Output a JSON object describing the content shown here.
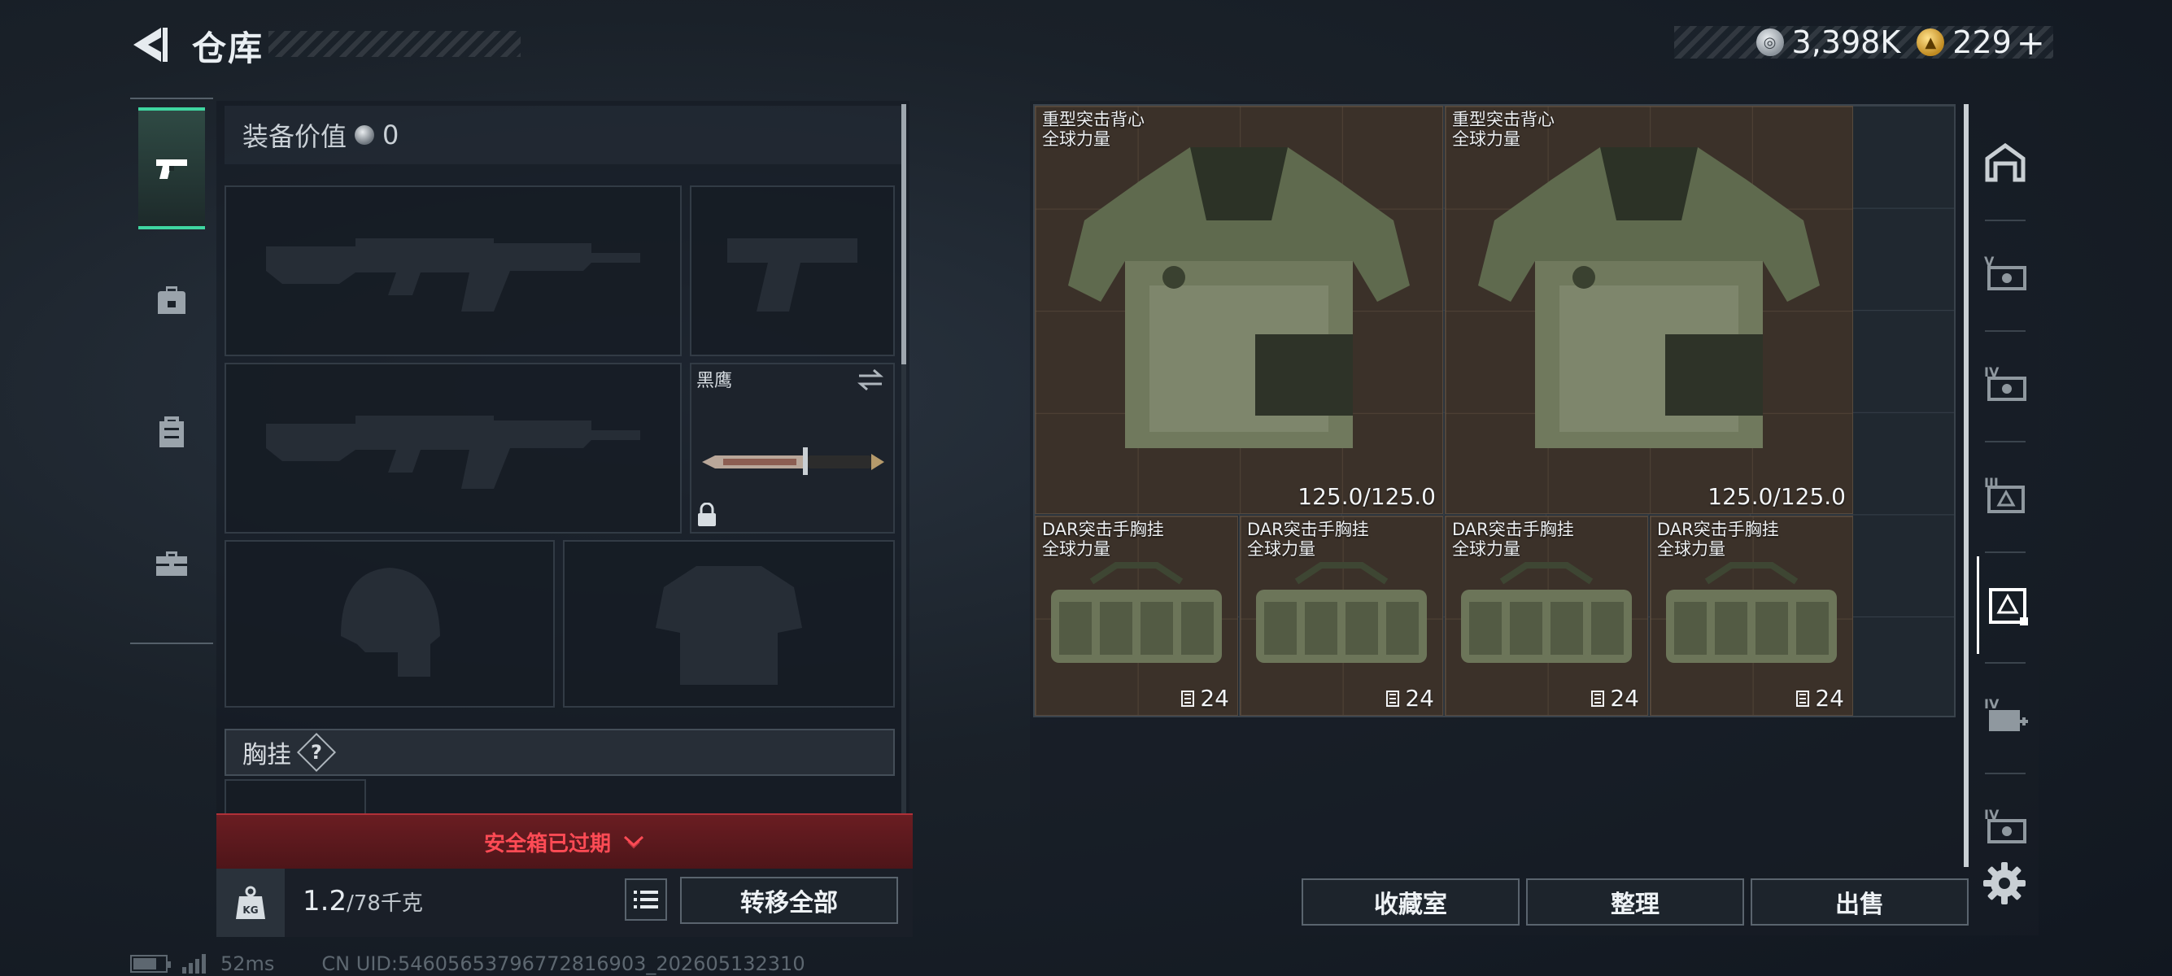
{
  "header": {
    "title": "仓库",
    "currencies": [
      {
        "icon": "silver-coin-icon",
        "amount": "3,398K"
      },
      {
        "icon": "gold-coin-icon",
        "amount": "229"
      }
    ],
    "add_label": "+"
  },
  "left_nav": {
    "items": [
      {
        "id": "weapons",
        "icon": "pistol-icon",
        "active": true
      },
      {
        "id": "backpack",
        "icon": "backpack-icon",
        "active": false
      },
      {
        "id": "container",
        "icon": "container-icon",
        "active": false
      },
      {
        "id": "toolbox",
        "icon": "toolbox-icon",
        "active": false
      }
    ]
  },
  "equipment": {
    "value_label": "装备价值",
    "value": "0",
    "knife_name": "黑鹰",
    "chest_rig_label": "胸挂",
    "help_label": "?"
  },
  "safe_box": {
    "expired_label": "安全箱已过期"
  },
  "weight": {
    "current": "1.2",
    "max": "/78千克",
    "icon_label": "KG"
  },
  "buttons": {
    "transfer_all": "转移全部",
    "collection": "收藏室",
    "organize": "整理",
    "sell": "出售"
  },
  "stash_items": [
    {
      "name": "重型突击背心",
      "sub": "全球力量",
      "durability": "125.0/125.0",
      "type": "vest"
    },
    {
      "name": "重型突击背心",
      "sub": "全球力量",
      "durability": "125.0/125.0",
      "type": "vest"
    },
    {
      "name": "DAR突击手胸挂",
      "sub": "全球力量",
      "capacity": "24",
      "type": "rig"
    },
    {
      "name": "DAR突击手胸挂",
      "sub": "全球力量",
      "capacity": "24",
      "type": "rig"
    },
    {
      "name": "DAR突击手胸挂",
      "sub": "全球力量",
      "capacity": "24",
      "type": "rig"
    },
    {
      "name": "DAR突击手胸挂",
      "sub": "全球力量",
      "capacity": "24",
      "type": "rig"
    }
  ],
  "right_rail": {
    "items": [
      {
        "icon": "stash-home-icon",
        "label": ""
      },
      {
        "icon": "tier-v-card-icon",
        "label": "V"
      },
      {
        "icon": "tier-iv-card-icon",
        "label": "IV"
      },
      {
        "icon": "tier-iii-armor-icon",
        "label": "III"
      },
      {
        "icon": "armor-filter-icon",
        "label": "",
        "active": true
      },
      {
        "icon": "tier-iv-medkit-icon",
        "label": "IV"
      },
      {
        "icon": "tier-iv-misc-icon",
        "label": "IV"
      }
    ]
  },
  "status": {
    "ping": "52ms",
    "uid": "CN UID:5460565379677281690​3_202605132310"
  },
  "colors": {
    "accent_green": "#3fd6a1",
    "warning_red": "#ff4b55",
    "item_bg": "#3b3129"
  }
}
